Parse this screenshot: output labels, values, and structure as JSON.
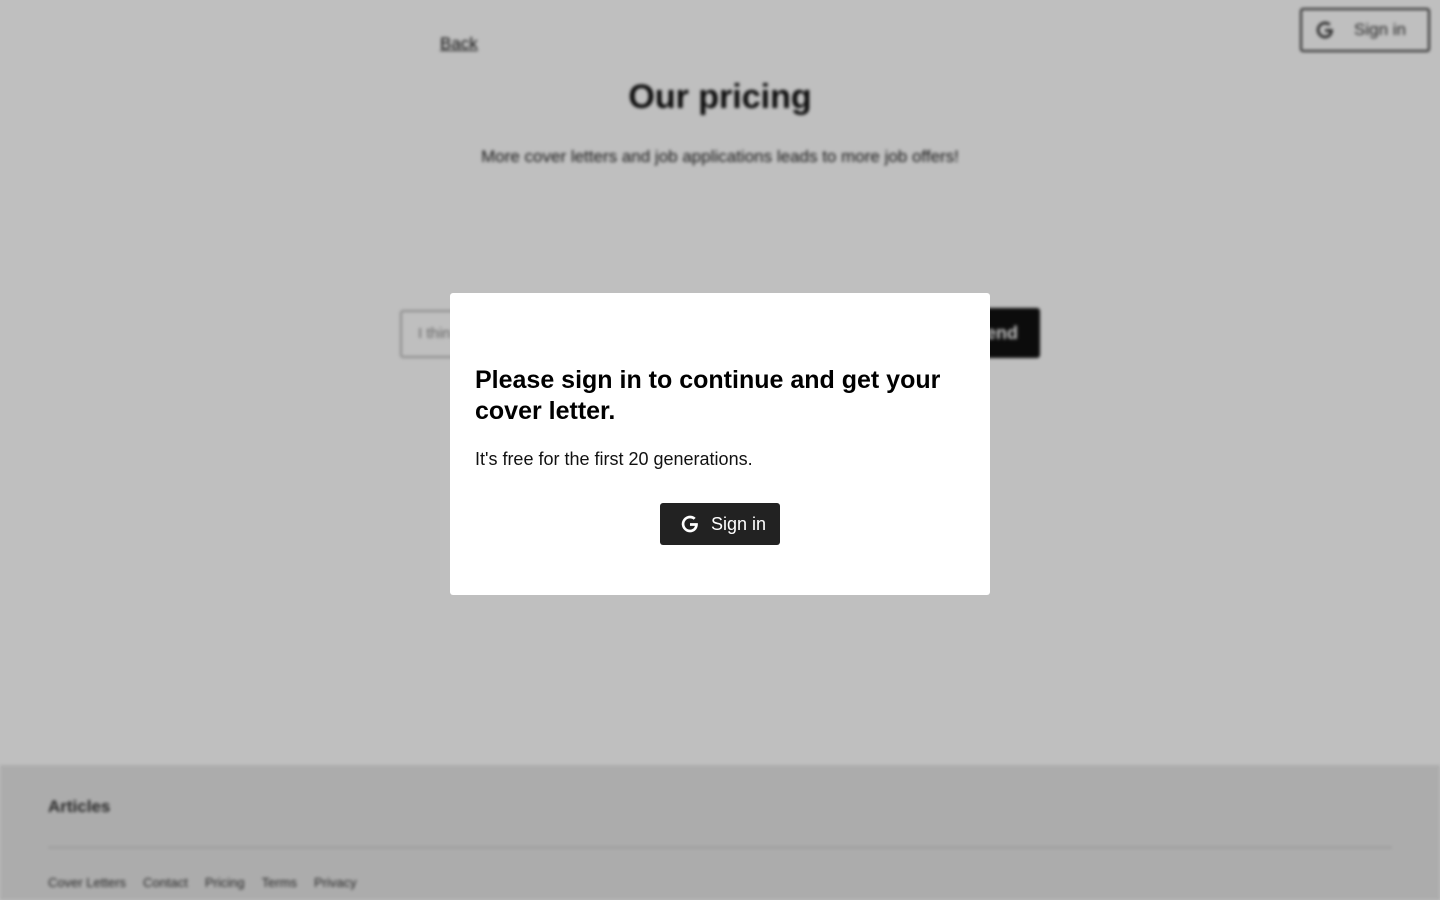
{
  "header": {
    "back_label": "Back",
    "signin_label": "Sign in"
  },
  "main": {
    "title": "Our pricing",
    "subtitle": "More cover letters and job applications leads to more job offers!",
    "input_placeholder": "I thin",
    "send_label": "Send"
  },
  "footer": {
    "heading": "Articles",
    "links": [
      "Cover Letters",
      "Contact",
      "Pricing",
      "Terms",
      "Privacy"
    ]
  },
  "modal": {
    "title": "Please sign in to continue and get your cover letter.",
    "text": "It's free for the first 20 generations.",
    "signin_label": "Sign in",
    "button_color": "#222222"
  },
  "icons": {
    "signin_icon": "google-icon"
  }
}
